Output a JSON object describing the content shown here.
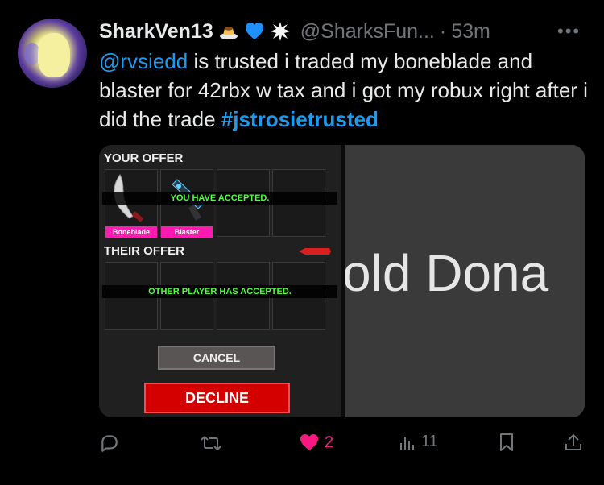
{
  "tweet": {
    "display_name": "SharkVen13",
    "emojis": [
      "pudding-emoji",
      "blue-heart-emoji",
      "boom-emoji"
    ],
    "handle": "@SharksFun...",
    "separator": "·",
    "time": "53m",
    "more": "•••",
    "text_mention": "@rvsiedd",
    "text_body": " is trusted i traded my boneblade and blaster for 42rbx w tax and i got my robux right after i did the trade ",
    "text_hashtag": "#jstrosietrusted"
  },
  "media": {
    "your_offer_label": "YOUR OFFER",
    "their_offer_label": "THEIR OFFER",
    "items": [
      {
        "name": "Boneblade",
        "icon": "boneblade-icon"
      },
      {
        "name": "Blaster",
        "icon": "blaster-icon"
      }
    ],
    "you_accepted": "YOU HAVE ACCEPTED.",
    "other_accepted": "OTHER PLAYER HAS ACCEPTED.",
    "cancel_label": "CANCEL",
    "decline_label": "DECLINE",
    "right_text": "old Dona"
  },
  "actions": {
    "reply_count": "",
    "retweet_count": "",
    "like_count": "2",
    "views_count": "11"
  },
  "colors": {
    "link": "#1d9bf0",
    "like": "#f91880",
    "muted": "#71767b",
    "accept_green": "#4cff3a",
    "item_tag_pink": "#ff1ab1",
    "decline_red": "#d40000"
  }
}
